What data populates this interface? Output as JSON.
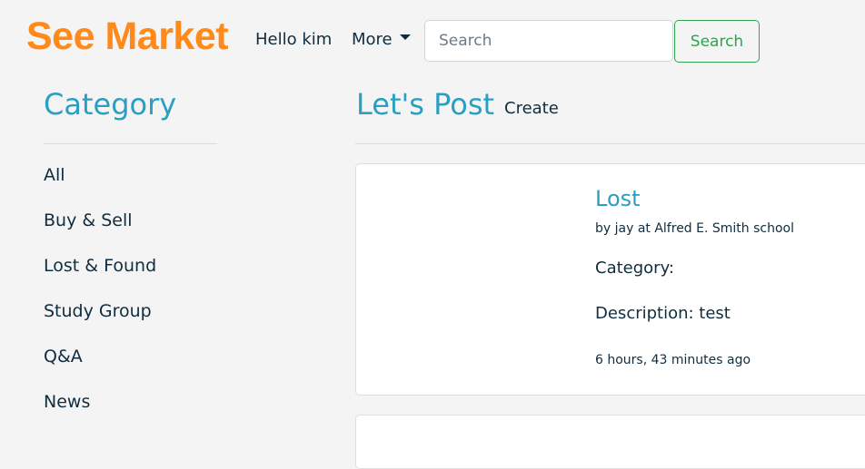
{
  "navbar": {
    "brand": "See Market",
    "greeting": "Hello kim",
    "more_label": "More",
    "search_placeholder": "Search",
    "search_button": "Search"
  },
  "sidebar": {
    "title": "Category",
    "items": [
      {
        "label": "All"
      },
      {
        "label": "Buy & Sell"
      },
      {
        "label": "Lost & Found"
      },
      {
        "label": "Study Group"
      },
      {
        "label": "Q&A"
      },
      {
        "label": "News"
      }
    ]
  },
  "main": {
    "title": "Let's Post",
    "create_label": "Create",
    "posts": [
      {
        "title": "Lost",
        "byline": "by jay at Alfred E. Smith school",
        "category_text": "Category:",
        "description_text": "Description: test",
        "time": "6 hours, 43 minutes ago"
      }
    ]
  },
  "colors": {
    "brand": "#ff8a1a",
    "accent": "#2a9fc1",
    "success": "#2ea44f",
    "text": "#0f2d3f",
    "background": "#f4f4f4"
  }
}
